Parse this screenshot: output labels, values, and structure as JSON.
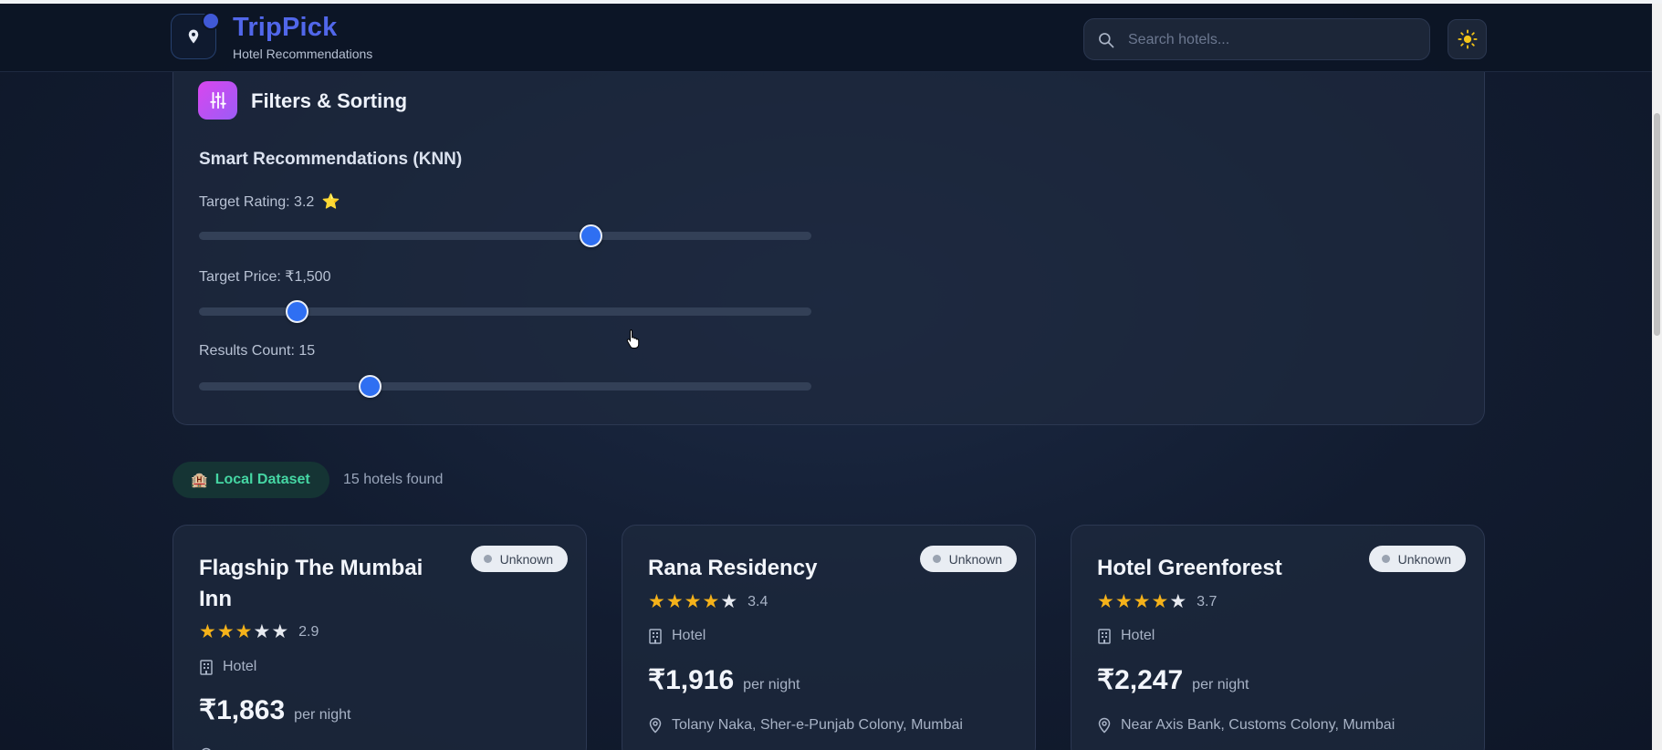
{
  "app": {
    "title": "TripPick",
    "subtitle": "Hotel Recommendations",
    "logo_icon": "map-pin-icon"
  },
  "search": {
    "placeholder": "Search hotels...",
    "value": ""
  },
  "theme_toggle": {
    "icon": "sun-icon"
  },
  "filters": {
    "title": "Filters & Sorting",
    "icon": "sliders-icon",
    "section_title": "Smart Recommendations (KNN)",
    "sliders": [
      {
        "label": "Target Rating: 3.2",
        "value": 3.2,
        "min": 0,
        "max": 5,
        "fraction": 0.64,
        "emoji": "⭐"
      },
      {
        "label": "Target Price: ₹1,500",
        "value": 1500,
        "fraction": 0.16
      },
      {
        "label": "Results Count: 15",
        "value": 15,
        "fraction": 0.28
      }
    ]
  },
  "results": {
    "dataset_label": "Local Dataset",
    "dataset_emoji": "🏨",
    "found_text": "15 hotels found"
  },
  "colors": {
    "accent": "#5167ea",
    "slider_thumb": "#2f6ff2",
    "star": "#f5b21a",
    "dataset_badge_text": "#45d6a3"
  },
  "hotels": [
    {
      "name": "Flagship The Mumbai Inn",
      "status": "Unknown",
      "rating": "2.9",
      "stars_filled": 3,
      "type": "Hotel",
      "price": "₹1,863",
      "per_night": "per night",
      "location": ""
    },
    {
      "name": "Rana Residency",
      "status": "Unknown",
      "rating": "3.4",
      "stars_filled": 4,
      "type": "Hotel",
      "price": "₹1,916",
      "per_night": "per night",
      "location": "Tolany Naka, Sher-e-Punjab Colony, Mumbai"
    },
    {
      "name": "Hotel Greenforest",
      "status": "Unknown",
      "rating": "3.7",
      "stars_filled": 4,
      "type": "Hotel",
      "price": "₹2,247",
      "per_night": "per night",
      "location": "Near Axis Bank, Customs Colony, Mumbai"
    }
  ]
}
